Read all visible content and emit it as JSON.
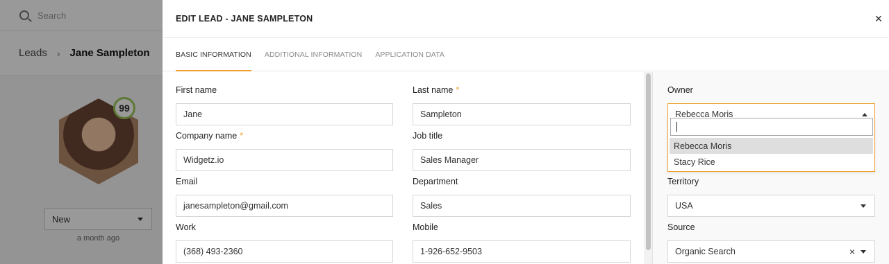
{
  "background": {
    "search_placeholder": "Search",
    "breadcrumb": {
      "parent": "Leads",
      "current": "Jane Sampleton"
    },
    "score": "99",
    "status": "New",
    "status_time": "a month ago"
  },
  "modal": {
    "title": "EDIT LEAD - JANE SAMPLETON",
    "close_glyph": "×",
    "tabs": [
      {
        "label": "BASIC INFORMATION",
        "active": true
      },
      {
        "label": "ADDITIONAL INFORMATION",
        "active": false
      },
      {
        "label": "APPLICATION DATA",
        "active": false
      }
    ],
    "fields": {
      "first_name": {
        "label": "First name",
        "value": "Jane"
      },
      "last_name": {
        "label": "Last name",
        "value": "Sampleton",
        "required_mark": "*"
      },
      "company_name": {
        "label": "Company name",
        "value": "Widgetz.io",
        "required_mark": "*"
      },
      "job_title": {
        "label": "Job title",
        "value": "Sales Manager"
      },
      "email": {
        "label": "Email",
        "value": "janesampleton@gmail.com"
      },
      "department": {
        "label": "Department",
        "value": "Sales"
      },
      "work": {
        "label": "Work",
        "value": "(368) 493-2360"
      },
      "mobile": {
        "label": "Mobile",
        "value": "1-926-652-9503"
      }
    },
    "side": {
      "owner": {
        "label": "Owner",
        "value": "Rebecca Moris",
        "options": [
          "Rebecca Moris",
          "Stacy Rice"
        ]
      },
      "territory": {
        "label": "Territory",
        "value": "USA"
      },
      "source": {
        "label": "Source",
        "value": "Organic Search",
        "clear_glyph": "×"
      }
    }
  },
  "colors": {
    "accent": "#f0a030",
    "score_ring": "#9bc85a"
  }
}
